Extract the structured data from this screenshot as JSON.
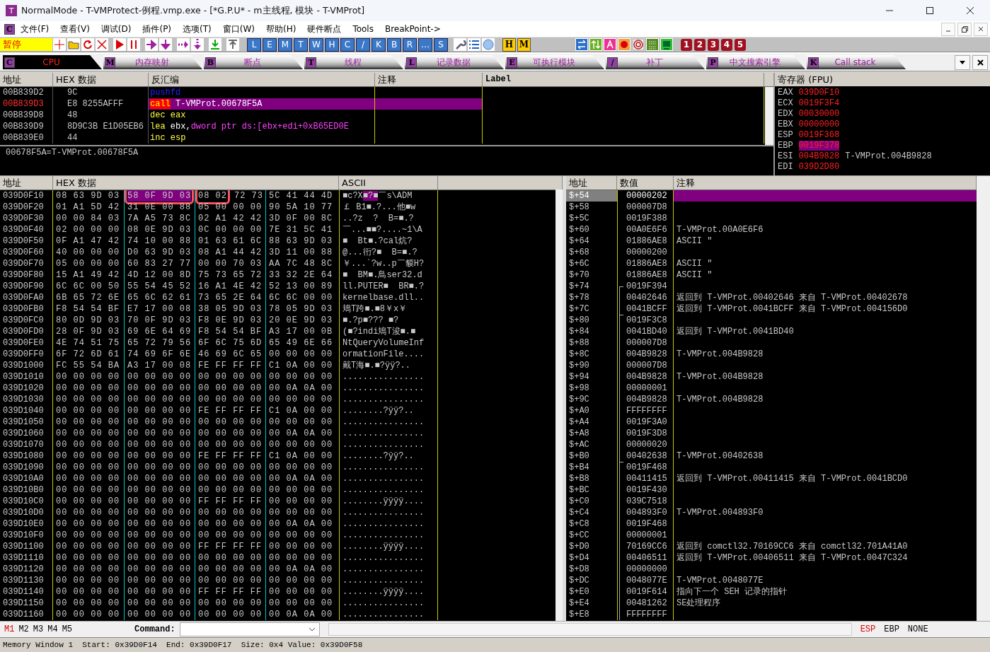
{
  "window": {
    "title": "NormalMode - T-VMProtect-例程.vmp.exe - [*G.P.U* - m主线程, 模块 - T-VMProt]",
    "app_key": "T"
  },
  "menu": {
    "key": "C",
    "items": [
      "文件(F)",
      "查看(V)",
      "调试(D)",
      "插件(P)",
      "选项(T)",
      "窗口(W)",
      "帮助(H)",
      "硬件断点",
      "Tools",
      "BreakPoint->"
    ]
  },
  "toolbar": {
    "status": "暂停",
    "letters": [
      "L",
      "E",
      "M",
      "T",
      "W",
      "H",
      "C",
      "/",
      "K",
      "B",
      "R",
      "…",
      "S"
    ],
    "marks": [
      "H",
      "M"
    ],
    "numbers": [
      "1",
      "2",
      "3",
      "4",
      "5"
    ]
  },
  "tabs": [
    {
      "key": "C",
      "label": "CPU",
      "selected": true
    },
    {
      "key": "M",
      "label": "内存映射",
      "selected": false
    },
    {
      "key": "B",
      "label": "断点",
      "selected": false
    },
    {
      "key": "T",
      "label": "线程",
      "selected": false
    },
    {
      "key": "L",
      "label": "记录数据",
      "selected": false
    },
    {
      "key": "E",
      "label": "可执行模块",
      "selected": false
    },
    {
      "key": "/",
      "label": "补丁",
      "selected": false
    },
    {
      "key": "P",
      "label": "中文搜索引擎",
      "selected": false
    },
    {
      "key": "K",
      "label": "Call stack",
      "selected": false
    }
  ],
  "disasm": {
    "columns": [
      "地址",
      "HEX 数据",
      "反汇编",
      "注释",
      "Label"
    ],
    "rows": [
      {
        "addr": "00B839D2",
        "hex": "9C",
        "current": false,
        "selected": false,
        "parts": [
          {
            "text": "pushfd",
            "kind": "flag"
          }
        ]
      },
      {
        "addr": "00B839D3",
        "hex": "E8 8255AFFF",
        "current": true,
        "selected": true,
        "parts": [
          {
            "text": "call",
            "kind": "call"
          },
          {
            "text": " T-VMProt.00678F5A",
            "kind": "plain"
          }
        ]
      },
      {
        "addr": "00B839D8",
        "hex": "48",
        "current": false,
        "selected": false,
        "parts": [
          {
            "text": "dec eax",
            "kind": "arith"
          }
        ]
      },
      {
        "addr": "00B839D9",
        "hex": "8D9C3B E1D05EB6",
        "current": false,
        "selected": false,
        "parts": [
          {
            "text": "lea",
            "kind": "arith"
          },
          {
            "text": " ebx,",
            "kind": "plain"
          },
          {
            "text": "dword ptr ds:[ebx+edi+0xB65ED0E",
            "kind": "mem"
          }
        ]
      },
      {
        "addr": "00B839E0",
        "hex": "44",
        "current": false,
        "selected": false,
        "parts": [
          {
            "text": "inc esp",
            "kind": "arith"
          }
        ]
      }
    ],
    "info": "00678F5A=T-VMProt.00678F5A"
  },
  "registers": {
    "title": "寄存器 (FPU)",
    "rows": [
      {
        "name": "EAX",
        "value": "039D0F10",
        "comment": "",
        "selected": false
      },
      {
        "name": "ECX",
        "value": "0019F3F4",
        "comment": "",
        "selected": false
      },
      {
        "name": "EDX",
        "value": "00030000",
        "comment": "",
        "selected": false
      },
      {
        "name": "EBX",
        "value": "00000000",
        "comment": "",
        "selected": false
      },
      {
        "name": "ESP",
        "value": "0019F368",
        "comment": "",
        "selected": false
      },
      {
        "name": "EBP",
        "value": "0019F378",
        "comment": "",
        "selected": true
      },
      {
        "name": "ESI",
        "value": "004B9828",
        "comment": "T-VMProt.004B9828",
        "selected": false
      },
      {
        "name": "EDI",
        "value": "039D2D80",
        "comment": "",
        "selected": false
      }
    ]
  },
  "dump": {
    "columns": [
      "地址",
      "HEX 数据",
      "ASCII"
    ],
    "rows": [
      {
        "addr": "039D0F10",
        "segments": [
          {
            "text": "08 63 9D 03",
            "selected": false,
            "marked": false
          },
          {
            "text": "58 0F 9D 03",
            "selected": true,
            "marked": true
          },
          {
            "text": "08 02",
            "selected": false,
            "marked": true
          },
          {
            "text": "72 73",
            "selected": false,
            "marked": false
          },
          {
            "text": "5C 41 44 4D",
            "selected": false,
            "marked": false
          }
        ],
        "ascii_parts": [
          {
            "text": "■c?X",
            "selected": false
          },
          {
            "text": "■?■",
            "selected": true
          },
          {
            "text": "￣s\\ADM",
            "selected": false
          }
        ]
      },
      {
        "addr": "039D0F20",
        "hex": "01 A1 5D 42 31 0E 00 88 05 00 00 00 90 5A 10 77",
        "ascii": "￡ B1■.?...他■w"
      },
      {
        "addr": "039D0F30",
        "hex": "00 00 84 03 7A A5 73 8C 02 A1 42 42 3D 0F 00 8C",
        "ascii": "..?z  ?  B=■.?"
      },
      {
        "addr": "039D0F40",
        "hex": "02 00 00 00 08 0E 9D 03 0C 00 00 00 7E 31 5C 41",
        "ascii": "￣...■■?....~1\\A"
      },
      {
        "addr": "039D0F50",
        "hex": "0F A1 47 42 74 10 00 88 01 63 61 6C 88 63 9D 03",
        "ascii": "■  Bt■.?cal炕?"
      },
      {
        "addr": "039D0F60",
        "hex": "40 00 00 00 D0 63 9D 03 08 A1 44 42 3D 11 00 88",
        "ascii": "@...衎?■  B=■.?"
      },
      {
        "addr": "039D0F70",
        "hex": "05 00 00 00 60 83 27 77 00 00 70 03 AA 7C 48 8C",
        "ascii": "￥...`?w..p￣貘H?"
      },
      {
        "addr": "039D0F80",
        "hex": "15 A1 49 42 4D 12 00 8D 75 73 65 72 33 32 2E 64",
        "ascii": "■  BM■.鳥ser32.d"
      },
      {
        "addr": "039D0F90",
        "hex": "6C 6C 00 50 55 54 45 52 16 A1 4E 42 52 13 00 89",
        "ascii": "ll.PUTER■  BR■.?"
      },
      {
        "addr": "039D0FA0",
        "hex": "6B 65 72 6E 65 6C 62 61 73 65 2E 64 6C 6C 00 00",
        "ascii": "kernelbase.dll.."
      },
      {
        "addr": "039D0FB0",
        "hex": "F8 54 54 BF E7 17 00 08 38 05 9D 03 78 05 9D 03",
        "ascii": "鳺T跨■.■8￥x￥"
      },
      {
        "addr": "039D0FC0",
        "hex": "80 0D 9D 03 70 0F 9D 03 F8 0E 9D 03 20 0E 9D 03",
        "ascii": "■.?p■??? ■?"
      },
      {
        "addr": "039D0FD0",
        "hex": "28 0F 9D 03 69 6E 64 69 F8 54 54 BF A3 17 00 0B",
        "ascii": "(■?indi鳺T浚■.■"
      },
      {
        "addr": "039D0FE0",
        "hex": "4E 74 51 75 65 72 79 56 6F 6C 75 6D 65 49 6E 66",
        "ascii": "NtQueryVolumeInf"
      },
      {
        "addr": "039D0FF0",
        "hex": "6F 72 6D 61 74 69 6F 6E 46 69 6C 65 00 00 00 00",
        "ascii": "ormationFile...."
      },
      {
        "addr": "039D1000",
        "hex": "FC 55 54 BA A3 17 00 08 FE FF FF FF C1 0A 00 00",
        "ascii": "戴T海■.■?ÿÿ?.."
      },
      {
        "addr": "039D1010",
        "hex": "00 00 00 00 00 00 00 00 00 00 00 00 00 00 00 00",
        "ascii": "................"
      },
      {
        "addr": "039D1020",
        "hex": "00 00 00 00 00 00 00 00 00 00 00 00 00 0A 0A 00",
        "ascii": "................"
      },
      {
        "addr": "039D1030",
        "hex": "00 00 00 00 00 00 00 00 00 00 00 00 00 00 00 00",
        "ascii": "................"
      },
      {
        "addr": "039D1040",
        "hex": "00 00 00 00 00 00 00 00 FE FF FF FF C1 0A 00 00",
        "ascii": "........?ÿÿ?.."
      },
      {
        "addr": "039D1050",
        "hex": "00 00 00 00 00 00 00 00 00 00 00 00 00 00 00 00",
        "ascii": "................"
      },
      {
        "addr": "039D1060",
        "hex": "00 00 00 00 00 00 00 00 00 00 00 00 00 0A 0A 00",
        "ascii": "................"
      },
      {
        "addr": "039D1070",
        "hex": "00 00 00 00 00 00 00 00 00 00 00 00 00 00 00 00",
        "ascii": "................"
      },
      {
        "addr": "039D1080",
        "hex": "00 00 00 00 00 00 00 00 FE FF FF FF C1 0A 00 00",
        "ascii": "........?ÿÿ?.."
      },
      {
        "addr": "039D1090",
        "hex": "00 00 00 00 00 00 00 00 00 00 00 00 00 00 00 00",
        "ascii": "................"
      },
      {
        "addr": "039D10A0",
        "hex": "00 00 00 00 00 00 00 00 00 00 00 00 00 0A 0A 00",
        "ascii": "................"
      },
      {
        "addr": "039D10B0",
        "hex": "00 00 00 00 00 00 00 00 00 00 00 00 00 00 00 00",
        "ascii": "................"
      },
      {
        "addr": "039D10C0",
        "hex": "00 00 00 00 00 00 00 00 FF FF FF FF 00 00 00 00",
        "ascii": "........ÿÿÿÿ...."
      },
      {
        "addr": "039D10D0",
        "hex": "00 00 00 00 00 00 00 00 00 00 00 00 00 00 00 00",
        "ascii": "................"
      },
      {
        "addr": "039D10E0",
        "hex": "00 00 00 00 00 00 00 00 00 00 00 00 00 0A 0A 00",
        "ascii": "................"
      },
      {
        "addr": "039D10F0",
        "hex": "00 00 00 00 00 00 00 00 00 00 00 00 00 00 00 00",
        "ascii": "................"
      },
      {
        "addr": "039D1100",
        "hex": "00 00 00 00 00 00 00 00 FF FF FF FF 00 00 00 00",
        "ascii": "........ÿÿÿÿ...."
      },
      {
        "addr": "039D1110",
        "hex": "00 00 00 00 00 00 00 00 00 00 00 00 00 00 00 00",
        "ascii": "................"
      },
      {
        "addr": "039D1120",
        "hex": "00 00 00 00 00 00 00 00 00 00 00 00 00 0A 0A 00",
        "ascii": "................"
      },
      {
        "addr": "039D1130",
        "hex": "00 00 00 00 00 00 00 00 00 00 00 00 00 00 00 00",
        "ascii": "................"
      },
      {
        "addr": "039D1140",
        "hex": "00 00 00 00 00 00 00 00 FF FF FF FF 00 00 00 00",
        "ascii": "........ÿÿÿÿ...."
      },
      {
        "addr": "039D1150",
        "hex": "00 00 00 00 00 00 00 00 00 00 00 00 00 00 00 00",
        "ascii": "................"
      },
      {
        "addr": "039D1160",
        "hex": "00 00 00 00 00 00 00 00 00 00 00 00 00 0A 0A 00",
        "ascii": "................"
      }
    ]
  },
  "stack": {
    "columns": [
      "地址",
      "数值",
      "注释"
    ],
    "rows": [
      {
        "addr": "$+54",
        "value": "00000202",
        "comment": "",
        "selected": true,
        "kind": "plain"
      },
      {
        "addr": "$+58",
        "value": "000007D8",
        "comment": "",
        "selected": false,
        "kind": "plain"
      },
      {
        "addr": "$+5C",
        "value": "0019F388",
        "comment": "",
        "selected": false,
        "kind": "plain"
      },
      {
        "addr": "$+60",
        "value": "00A0E6F6",
        "comment": "T-VMProt.00A0E6F6",
        "selected": false,
        "kind": "plain"
      },
      {
        "addr": "$+64",
        "value": "01886AE8",
        "comment": "ASCII \"",
        "selected": false,
        "kind": "plain"
      },
      {
        "addr": "$+68",
        "value": "00000200",
        "comment": "",
        "selected": false,
        "kind": "plain"
      },
      {
        "addr": "$+6C",
        "value": "01886AE8",
        "comment": "ASCII \"",
        "selected": false,
        "kind": "plain"
      },
      {
        "addr": "$+70",
        "value": "01886AE8",
        "comment": "ASCII \"",
        "selected": false,
        "kind": "plain"
      },
      {
        "addr": "$+74",
        "value": "0019F394",
        "comment": "",
        "selected": false,
        "kind": "top"
      },
      {
        "addr": "$+78",
        "value": "00402646",
        "comment": "返回到 T-VMProt.00402646 来自 T-VMProt.00402678",
        "selected": false,
        "kind": "mid"
      },
      {
        "addr": "$+7C",
        "value": "0041BCFF",
        "comment": "返回到 T-VMProt.0041BCFF 来自 T-VMProt.004156D0",
        "selected": false,
        "kind": "mid"
      },
      {
        "addr": "$+80",
        "value": "0019F3C8",
        "comment": "",
        "selected": false,
        "kind": "joint"
      },
      {
        "addr": "$+84",
        "value": "0041BD40",
        "comment": "返回到 T-VMProt.0041BD40",
        "selected": false,
        "kind": "mid"
      },
      {
        "addr": "$+88",
        "value": "000007D8",
        "comment": "",
        "selected": false,
        "kind": "mid"
      },
      {
        "addr": "$+8C",
        "value": "004B9828",
        "comment": "T-VMProt.004B9828",
        "selected": false,
        "kind": "mid"
      },
      {
        "addr": "$+90",
        "value": "000007D8",
        "comment": "",
        "selected": false,
        "kind": "mid"
      },
      {
        "addr": "$+94",
        "value": "004B9828",
        "comment": "T-VMProt.004B9828",
        "selected": false,
        "kind": "mid"
      },
      {
        "addr": "$+98",
        "value": "00000001",
        "comment": "",
        "selected": false,
        "kind": "mid"
      },
      {
        "addr": "$+9C",
        "value": "004B9828",
        "comment": "T-VMProt.004B9828",
        "selected": false,
        "kind": "mid"
      },
      {
        "addr": "$+A0",
        "value": "FFFFFFFF",
        "comment": "",
        "selected": false,
        "kind": "mid"
      },
      {
        "addr": "$+A4",
        "value": "0019F3A0",
        "comment": "",
        "selected": false,
        "kind": "mid"
      },
      {
        "addr": "$+A8",
        "value": "0019F3D8",
        "comment": "",
        "selected": false,
        "kind": "mid"
      },
      {
        "addr": "$+AC",
        "value": "00000020",
        "comment": "",
        "selected": false,
        "kind": "mid"
      },
      {
        "addr": "$+B0",
        "value": "00402638",
        "comment": "T-VMProt.00402638",
        "selected": false,
        "kind": "mid"
      },
      {
        "addr": "$+B4",
        "value": "0019F468",
        "comment": "",
        "selected": false,
        "kind": "joint"
      },
      {
        "addr": "$+B8",
        "value": "00411415",
        "comment": "返回到 T-VMProt.00411415 来自 T-VMProt.0041BCD0",
        "selected": false,
        "kind": "mid"
      },
      {
        "addr": "$+BC",
        "value": "0019F430",
        "comment": "",
        "selected": false,
        "kind": "mid"
      },
      {
        "addr": "$+C0",
        "value": "039C7518",
        "comment": "",
        "selected": false,
        "kind": "mid"
      },
      {
        "addr": "$+C4",
        "value": "004893F0",
        "comment": "T-VMProt.004893F0",
        "selected": false,
        "kind": "mid"
      },
      {
        "addr": "$+C8",
        "value": "0019F468",
        "comment": "",
        "selected": false,
        "kind": "mid"
      },
      {
        "addr": "$+CC",
        "value": "00000001",
        "comment": "",
        "selected": false,
        "kind": "mid"
      },
      {
        "addr": "$+D0",
        "value": "70169CC6",
        "comment": "返回到 comctl32.70169CC6 来自 comctl32.701A41A0",
        "selected": false,
        "kind": "mid"
      },
      {
        "addr": "$+D4",
        "value": "00406511",
        "comment": "返回到 T-VMProt.00406511 来自 T-VMProt.0047C324",
        "selected": false,
        "kind": "mid"
      },
      {
        "addr": "$+D8",
        "value": "00000000",
        "comment": "",
        "selected": false,
        "kind": "mid"
      },
      {
        "addr": "$+DC",
        "value": "0048077E",
        "comment": "T-VMProt.0048077E",
        "selected": false,
        "kind": "mid"
      },
      {
        "addr": "$+E0",
        "value": "0019F614",
        "comment": "指向下一个 SEH 记录的指针",
        "selected": false,
        "kind": "mid"
      },
      {
        "addr": "$+E4",
        "value": "00481262",
        "comment": "SE处理程序",
        "selected": false,
        "kind": "mid"
      },
      {
        "addr": "$+E8",
        "value": "FFFFFFFF",
        "comment": "",
        "selected": false,
        "kind": "mid"
      }
    ]
  },
  "command_bar": {
    "memory_tabs": [
      {
        "label": "M1",
        "selected": true
      },
      {
        "label": "M2",
        "selected": false
      },
      {
        "label": "M3",
        "selected": false
      },
      {
        "label": "M4",
        "selected": false
      },
      {
        "label": "M5",
        "selected": false
      }
    ],
    "command_label": "Command:",
    "stack_modes": [
      {
        "label": "ESP",
        "selected": true
      },
      {
        "label": "EBP",
        "selected": false
      },
      {
        "label": "NONE",
        "selected": false
      }
    ]
  },
  "status_bar": "Memory Window 1  Start: 0x39D0F14  End: 0x39D0F17  Size: 0x4 Value: 0x39D0F58"
}
